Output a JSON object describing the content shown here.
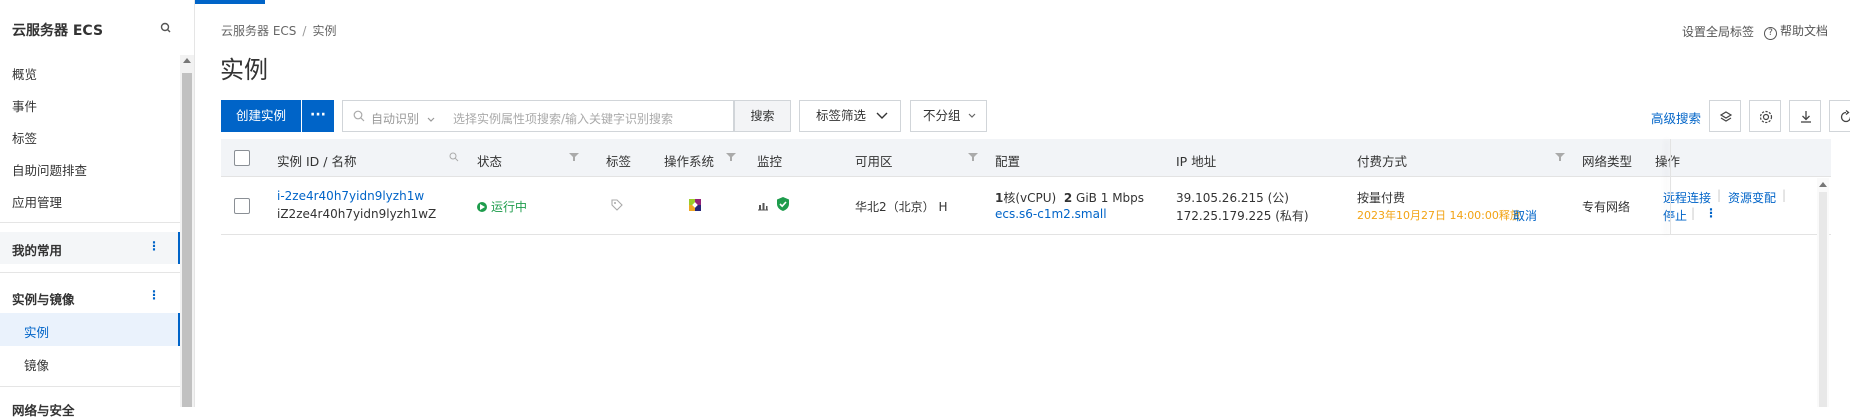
{
  "sidebar": {
    "title": "云服务器 ECS",
    "items": [
      "概览",
      "事件",
      "标签",
      "自助问题排查",
      "应用管理"
    ],
    "groups": [
      {
        "label": "我的常用",
        "dots": "⋮"
      },
      {
        "label": "实例与镜像",
        "dots": "⋮"
      }
    ],
    "sub_items": [
      {
        "label": "实例",
        "active": true
      },
      {
        "label": "镜像",
        "active": false
      }
    ],
    "cut_off_item": "网络与安全"
  },
  "header": {
    "breadcrumb": [
      "云服务器 ECS",
      "实例"
    ],
    "breadcrumb_sep": "/",
    "global_tags": "设置全局标签",
    "help_icon": "?",
    "help": "帮助文档",
    "title": "实例"
  },
  "toolbar": {
    "create_label": "创建实例",
    "more_label": "···",
    "search_mode": "自动识别",
    "search_placeholder": "选择实例属性项搜索/输入关键字识别搜索",
    "search_button": "搜索",
    "tag_filter": "标签筛选",
    "group_select": "不分组",
    "advanced_search": "高级搜索"
  },
  "table": {
    "columns": [
      "实例 ID / 名称",
      "状态",
      "标签",
      "操作系统",
      "监控",
      "可用区",
      "配置",
      "IP 地址",
      "付费方式",
      "网络类型",
      "操作"
    ],
    "rows": [
      {
        "instance_id": "i-2ze4r40h7yidn9lyzh1w",
        "instance_name": "iZ2ze4r40h7yidn9lyzh1wZ",
        "status": "运行中",
        "zone": "华北2（北京） H",
        "cpu_label": "1核(vCPU)",
        "cpu_count": "1",
        "cpu_unit": "核(vCPU)",
        "mem_value": "2",
        "mem_unit": " GiB",
        "bandwidth": "1 Mbps",
        "spec": "ecs.s6-c1m2.small",
        "ip_public": "39.105.26.215 (公)",
        "ip_private": "172.25.179.225 (私有)",
        "billing": "按量付费",
        "release_time": "2023年10月27日 14:00:00释放",
        "cancel": "取消",
        "network": "专有网络",
        "actions": [
          "远程连接",
          "资源变配",
          "停止"
        ],
        "more_actions": "⋮"
      }
    ]
  },
  "colors": {
    "primary": "#0064c8",
    "running": "#1e9c4c",
    "warning": "#f2a314"
  }
}
